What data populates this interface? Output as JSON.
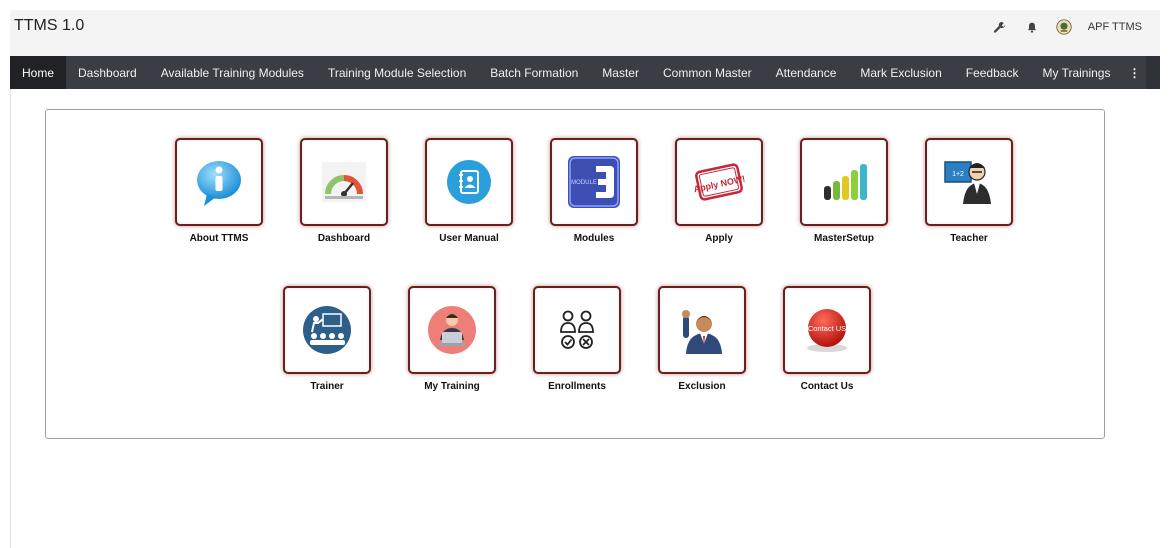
{
  "header": {
    "app_title": "TTMS 1.0",
    "user_name": "APF TTMS",
    "icons": [
      "wrench-icon",
      "bell-icon",
      "emblem-icon"
    ]
  },
  "nav": {
    "items": [
      {
        "label": "Home",
        "active": true
      },
      {
        "label": "Dashboard"
      },
      {
        "label": "Available Training Modules"
      },
      {
        "label": "Training Module Selection"
      },
      {
        "label": "Batch Formation"
      },
      {
        "label": "Master"
      },
      {
        "label": "Common Master"
      },
      {
        "label": "Attendance"
      },
      {
        "label": "Mark Exclusion"
      },
      {
        "label": "Feedback"
      },
      {
        "label": "My Trainings"
      }
    ],
    "more": "⋮"
  },
  "tiles": [
    {
      "label": "About TTMS",
      "icon": "info-icon"
    },
    {
      "label": "Dashboard",
      "icon": "gauge-icon"
    },
    {
      "label": "User Manual",
      "icon": "manual-icon"
    },
    {
      "label": "Modules",
      "icon": "module-icon",
      "icon_text": "MODULE"
    },
    {
      "label": "Apply",
      "icon": "apply-stamp-icon",
      "icon_text": "Apply NOW!"
    },
    {
      "label": "MasterSetup",
      "icon": "bar-chart-icon"
    },
    {
      "label": "Teacher",
      "icon": "teacher-icon"
    },
    {
      "label": "Trainer",
      "icon": "trainer-icon"
    },
    {
      "label": "My Training",
      "icon": "laptop-user-icon"
    },
    {
      "label": "Enrollments",
      "icon": "enrollments-icon"
    },
    {
      "label": "Exclusion",
      "icon": "raised-hand-icon"
    },
    {
      "label": "Contact Us",
      "icon": "contact-button-icon",
      "icon_text": "Contact US"
    }
  ],
  "colors": {
    "navbar": "#3a3d43",
    "nav_active": "#202226",
    "tile_border": "#6b1f1f"
  }
}
